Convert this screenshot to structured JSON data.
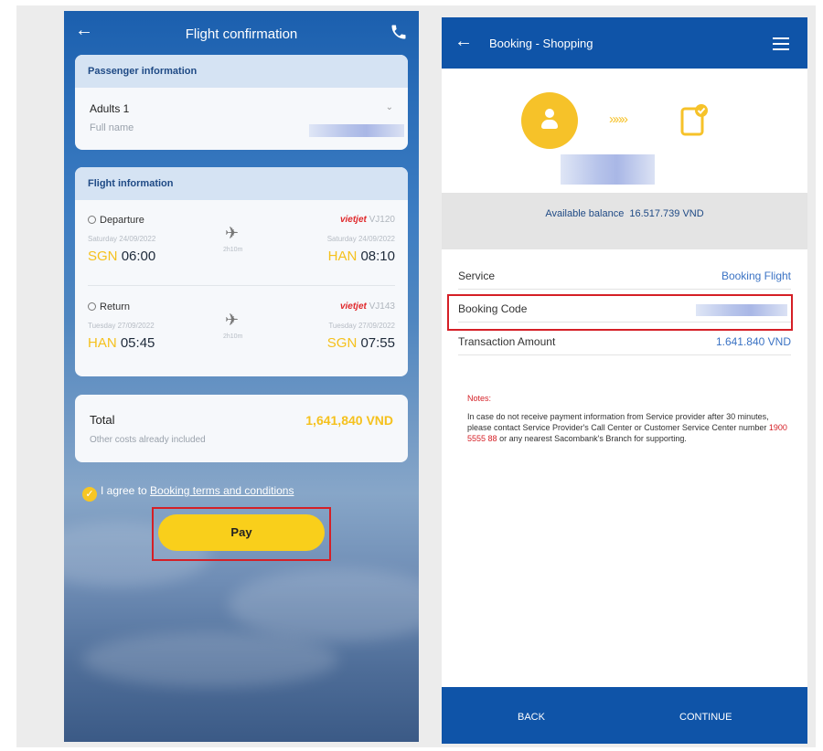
{
  "left": {
    "header": {
      "title": "Flight confirmation"
    },
    "passenger": {
      "heading": "Passenger information",
      "adults_label": "Adults 1",
      "fullname_label": "Full name"
    },
    "flight": {
      "heading": "Flight information",
      "departure": {
        "label": "Departure",
        "date_from": "Saturday 24/09/2022",
        "from_code": "SGN",
        "from_time": "06:00",
        "duration": "2h10m",
        "airline": "vietjet",
        "flight_no": "VJ120",
        "date_to": "Saturday 24/09/2022",
        "to_code": "HAN",
        "to_time": "08:10"
      },
      "return": {
        "label": "Return",
        "date_from": "Tuesday 27/09/2022",
        "from_code": "HAN",
        "from_time": "05:45",
        "duration": "2h10m",
        "airline": "vietjet",
        "flight_no": "VJ143",
        "date_to": "Tuesday 27/09/2022",
        "to_code": "SGN",
        "to_time": "07:55"
      }
    },
    "total": {
      "label": "Total",
      "value": "1,641,840 VND",
      "sub": "Other costs already included"
    },
    "agree": {
      "prefix": "I agree to",
      "link": "Booking terms and conditions"
    },
    "pay_label": "Pay"
  },
  "right": {
    "header": {
      "title": "Booking - Shopping"
    },
    "balance": {
      "label": "Available balance",
      "value": "16.517.739 VND"
    },
    "details": [
      {
        "key": "Service",
        "value": "Booking Flight"
      },
      {
        "key": "Booking Code",
        "value": ""
      },
      {
        "key": "Transaction Amount",
        "value": "1.641.840 VND"
      }
    ],
    "notes": {
      "title": "Notes:",
      "text_before": "In case do not receive payment information from Service provider after 30 minutes, please contact Service Provider's Call Center or Customer Service Center number",
      "phone": "1900 5555 88",
      "text_after": "or any nearest Sacombank's Branch for supporting."
    },
    "footer": {
      "back": "BACK",
      "continue": "CONTINUE"
    }
  },
  "colors": {
    "primary_blue": "#0f54a8",
    "accent_yellow": "#f9cf1b",
    "highlight_red": "#d51f26"
  }
}
